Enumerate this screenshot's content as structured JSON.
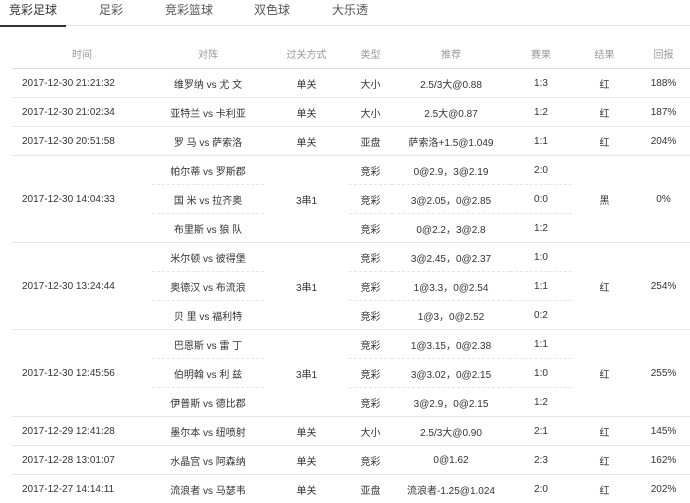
{
  "tabs": [
    {
      "label": "竞彩足球",
      "active": true
    },
    {
      "label": "足彩",
      "active": false
    },
    {
      "label": "竞彩篮球",
      "active": false
    },
    {
      "label": "双色球",
      "active": false
    },
    {
      "label": "大乐透",
      "active": false
    }
  ],
  "headers": [
    "时间",
    "对阵",
    "过关方式",
    "类型",
    "推荐",
    "赛果",
    "结果",
    "回报"
  ],
  "groups": [
    {
      "time": "2017-12-30 21:21:32",
      "mode": "单关",
      "result": "红",
      "return": "188%",
      "matches": [
        {
          "teams": "维罗纳 vs 尤 文",
          "type": "大小",
          "pick": "2.5/3大@0.88",
          "score": "1:3"
        }
      ]
    },
    {
      "time": "2017-12-30 21:02:34",
      "mode": "单关",
      "result": "红",
      "return": "187%",
      "matches": [
        {
          "teams": "亚特兰 vs 卡利亚",
          "type": "大小",
          "pick": "2.5大@0.87",
          "score": "1:2"
        }
      ]
    },
    {
      "time": "2017-12-30 20:51:58",
      "mode": "单关",
      "result": "红",
      "return": "204%",
      "matches": [
        {
          "teams": "罗 马 vs 萨索洛",
          "type": "亚盘",
          "pick": "萨索洛+1.5@1.049",
          "score": "1:1"
        }
      ]
    },
    {
      "time": "2017-12-30 14:04:33",
      "mode": "3串1",
      "result": "黑",
      "return": "0%",
      "matches": [
        {
          "teams": "帕尔蒂 vs 罗斯郡",
          "type": "竞彩",
          "pick": "0@2.9，3@2.19",
          "score": "2:0"
        },
        {
          "teams": "国 米 vs 拉齐奥",
          "type": "竞彩",
          "pick": "3@2.05，0@2.85",
          "score": "0:0"
        },
        {
          "teams": "布里斯 vs 狼 队",
          "type": "竞彩",
          "pick": "0@2.2，3@2.8",
          "score": "1:2"
        }
      ]
    },
    {
      "time": "2017-12-30 13:24:44",
      "mode": "3串1",
      "result": "红",
      "return": "254%",
      "matches": [
        {
          "teams": "米尔顿 vs 彼得堡",
          "type": "竞彩",
          "pick": "3@2.45，0@2.37",
          "score": "1:0"
        },
        {
          "teams": "奥德汉 vs 布流浪",
          "type": "竞彩",
          "pick": "1@3.3，0@2.54",
          "score": "1:1"
        },
        {
          "teams": "贝 里 vs 福利特",
          "type": "竞彩",
          "pick": "1@3，0@2.52",
          "score": "0:2"
        }
      ]
    },
    {
      "time": "2017-12-30 12:45:56",
      "mode": "3串1",
      "result": "红",
      "return": "255%",
      "matches": [
        {
          "teams": "巴恩斯 vs 雷 丁",
          "type": "竞彩",
          "pick": "1@3.15，0@2.38",
          "score": "1:1"
        },
        {
          "teams": "伯明翰 vs 利 兹",
          "type": "竞彩",
          "pick": "3@3.02，0@2.15",
          "score": "1:0"
        },
        {
          "teams": "伊普斯 vs 德比郡",
          "type": "竞彩",
          "pick": "3@2.9，0@2.15",
          "score": "1:2"
        }
      ]
    },
    {
      "time": "2017-12-29 12:41:28",
      "mode": "单关",
      "result": "红",
      "return": "145%",
      "matches": [
        {
          "teams": "墨尔本 vs 纽喷射",
          "type": "大小",
          "pick": "2.5/3大@0.90",
          "score": "2:1"
        }
      ]
    },
    {
      "time": "2017-12-28 13:01:07",
      "mode": "单关",
      "result": "红",
      "return": "162%",
      "matches": [
        {
          "teams": "水晶宫 vs 阿森纳",
          "type": "竞彩",
          "pick": "0@1.62",
          "score": "2:3"
        }
      ]
    },
    {
      "time": "2017-12-27 14:14:11",
      "mode": "单关",
      "result": "红",
      "return": "202%",
      "matches": [
        {
          "teams": "流浪者 vs 马瑟韦",
          "type": "亚盘",
          "pick": "流浪者-1.25@1.024",
          "score": "2:0"
        }
      ]
    }
  ]
}
